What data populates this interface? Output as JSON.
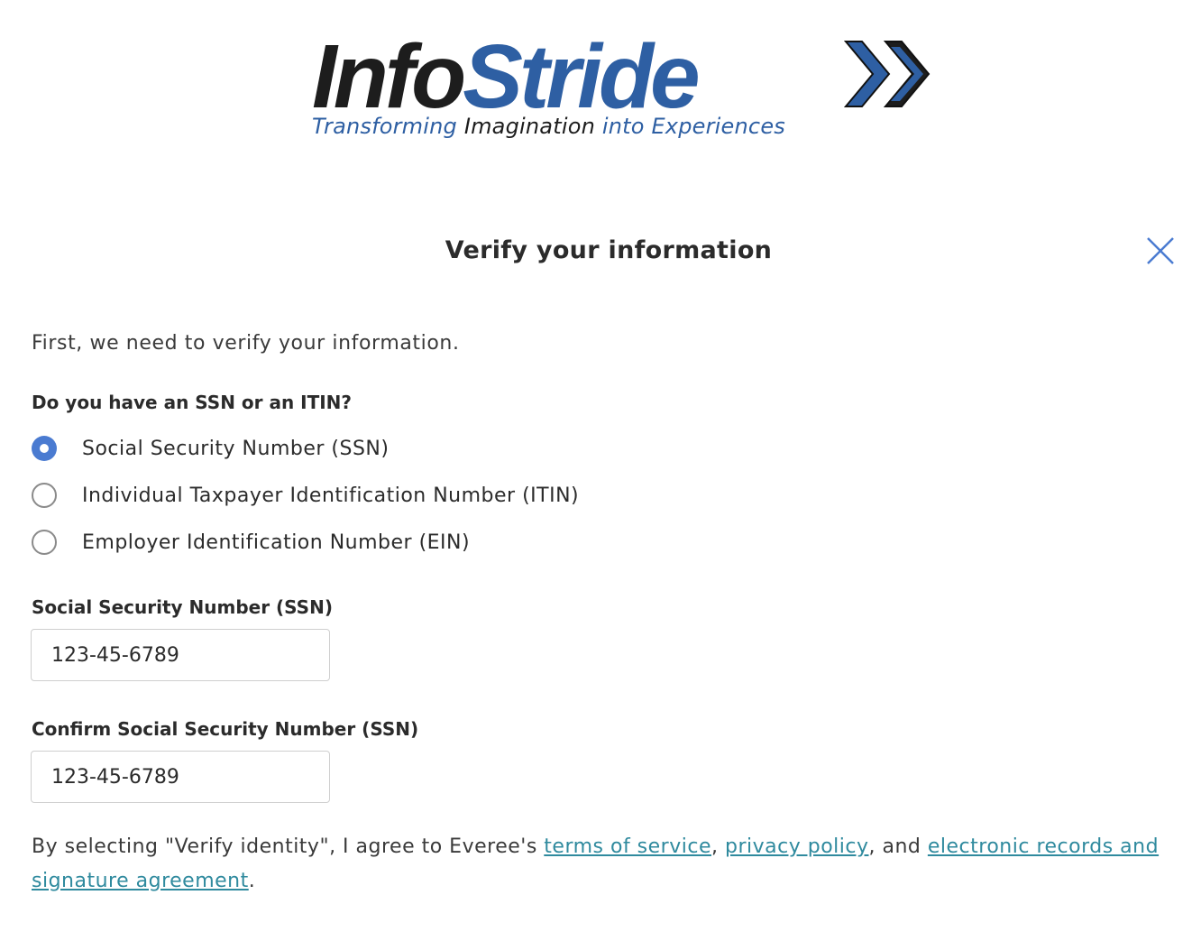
{
  "logo": {
    "word_part1": "Info",
    "word_part2": "Stride",
    "tagline_part1": "Transforming",
    "tagline_part2": "Imagination",
    "tagline_part3": "into Experiences",
    "icon": "double-chevron-right-icon",
    "brand_blue": "#2e5fa3",
    "brand_dark": "#1d1d1d"
  },
  "header": {
    "title": "Verify your information",
    "close_icon": "close-icon"
  },
  "form": {
    "intro": "First, we need to verify your information.",
    "question": "Do you have an SSN or an ITIN?",
    "options": [
      {
        "label": "Social Security Number (SSN)",
        "selected": true
      },
      {
        "label": "Individual Taxpayer Identification Number (ITIN)",
        "selected": false
      },
      {
        "label": "Employer Identification Number (EIN)",
        "selected": false
      }
    ],
    "ssn_label": "Social Security Number (SSN)",
    "ssn_value": "123-45-6789",
    "confirm_label": "Confirm Social Security Number (SSN)",
    "confirm_value": "123-45-6789"
  },
  "consent": {
    "prefix": "By selecting \"Verify identity\", I agree to Everee's ",
    "terms_link": "terms of service",
    "sep1": ", ",
    "privacy_link": "privacy policy",
    "sep2": ", and ",
    "records_link": "electronic records and signature agreement",
    "suffix": "."
  },
  "colors": {
    "accent": "#4a7bd1",
    "link": "#2f8a9e",
    "close_icon": "#4a7bd1"
  }
}
